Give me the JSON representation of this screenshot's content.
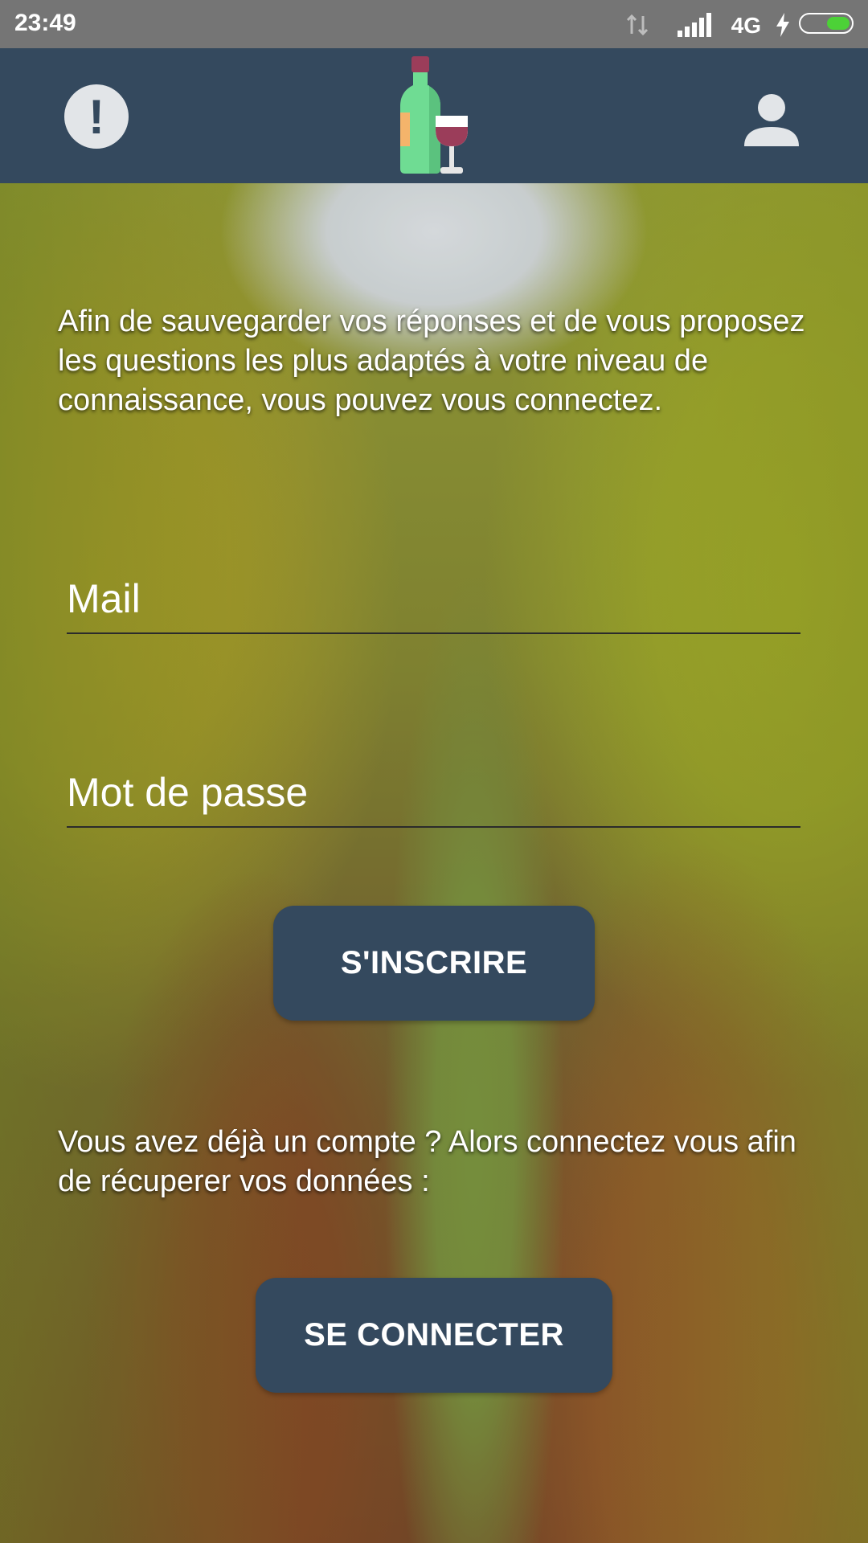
{
  "status_bar": {
    "time": "23:49",
    "network_type": "4G",
    "icons": [
      "data-arrows-icon",
      "signal-icon",
      "charging-bolt-icon",
      "battery-icon"
    ],
    "battery_color": "#4cd137"
  },
  "header": {
    "background": "#34495e",
    "left_icon": "alert-circle-icon",
    "logo_icon": "wine-bottle-glass-logo",
    "right_icon": "user-icon"
  },
  "intro": {
    "text": "Afin de sauvegarder vos réponses et de vous proposez les questions les plus adaptés à votre niveau de connaissance, vous pouvez vous connectez."
  },
  "form": {
    "mail_placeholder": "Mail",
    "mail_value": "",
    "password_placeholder": "Mot de passe",
    "password_value": "",
    "signup_label": "S'INSCRIRE"
  },
  "login": {
    "text": "Vous avez déjà un compte ? Alors connectez vous afin de récuperer vos données :",
    "button_label": "SE CONNECTER"
  }
}
